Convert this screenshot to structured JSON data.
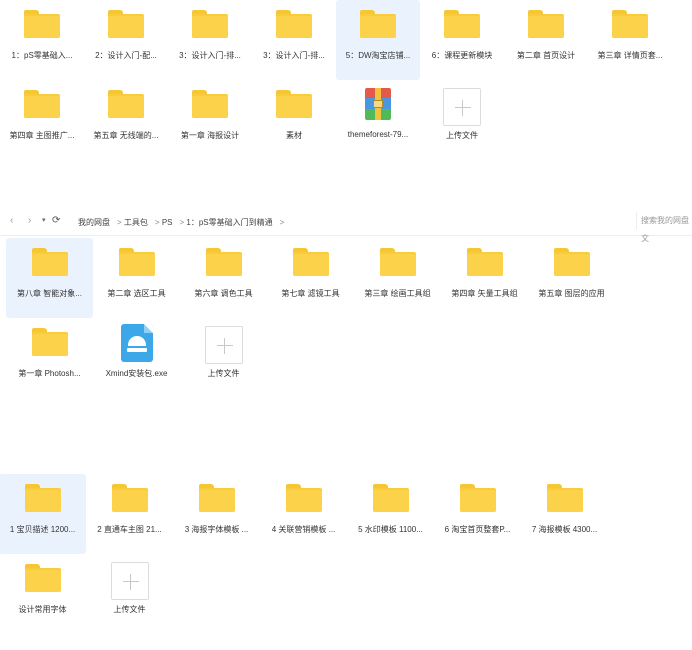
{
  "panel1": {
    "items": [
      {
        "label": "1：pS零基础入...",
        "type": "folder"
      },
      {
        "label": "2：设计入门-配...",
        "type": "folder"
      },
      {
        "label": "3：设计入门-排...",
        "type": "folder"
      },
      {
        "label": "3：设计入门-排...",
        "type": "folder"
      },
      {
        "label": "5：DW淘宝店铺...",
        "type": "folder",
        "selected": true
      },
      {
        "label": "6：课程更新模块",
        "type": "folder"
      },
      {
        "label": "第二章 首页设计",
        "type": "folder"
      },
      {
        "label": "第三章 详情页套...",
        "type": "folder"
      },
      {
        "label": "第四章 主图推广...",
        "type": "folder"
      },
      {
        "label": "第五章 无线端的...",
        "type": "folder"
      },
      {
        "label": "第一章 海报设计",
        "type": "folder"
      },
      {
        "label": "素材",
        "type": "folder"
      },
      {
        "label": "themeforest-79...",
        "type": "archive"
      },
      {
        "label": "上传文件",
        "type": "upload"
      }
    ]
  },
  "toolbar": {
    "back_icon": "chevron-left-icon",
    "forward_icon": "chevron-right-icon",
    "dropdown_icon": "caret-down-icon",
    "refresh_icon": "refresh-icon",
    "breadcrumbs": [
      "我的网盘",
      "工具包",
      "PS",
      "1：pS零基础入门到精通"
    ],
    "search_placeholder": "搜索我的网盘文"
  },
  "panel2": {
    "items": [
      {
        "label": "第八章 智能对象...",
        "type": "folder",
        "selected": true
      },
      {
        "label": "第二章 选区工具",
        "type": "folder"
      },
      {
        "label": "第六章 调色工具",
        "type": "folder"
      },
      {
        "label": "第七章 滤镜工具",
        "type": "folder"
      },
      {
        "label": "第三章 绘画工具组",
        "type": "folder"
      },
      {
        "label": "第四章 矢量工具组",
        "type": "folder"
      },
      {
        "label": "第五章 图层的应用",
        "type": "folder"
      },
      {
        "label": "第一章 Photosh...",
        "type": "folder"
      },
      {
        "label": "Xmind安装包.exe",
        "type": "exe"
      },
      {
        "label": "上传文件",
        "type": "upload"
      }
    ]
  },
  "panel3": {
    "items": [
      {
        "label": "1 宝贝描述 1200...",
        "type": "folder",
        "selected": true
      },
      {
        "label": "2 直通车主图 21...",
        "type": "folder"
      },
      {
        "label": "3 海报字体模板 ...",
        "type": "folder"
      },
      {
        "label": "4 关联营销模板 ...",
        "type": "folder"
      },
      {
        "label": "5 水印模板 1100...",
        "type": "folder"
      },
      {
        "label": "6 淘宝首页整套P...",
        "type": "folder"
      },
      {
        "label": "7 海报模板 4300...",
        "type": "folder"
      },
      {
        "label": "设计常用字体",
        "type": "folder"
      },
      {
        "label": "上传文件",
        "type": "upload"
      }
    ]
  }
}
